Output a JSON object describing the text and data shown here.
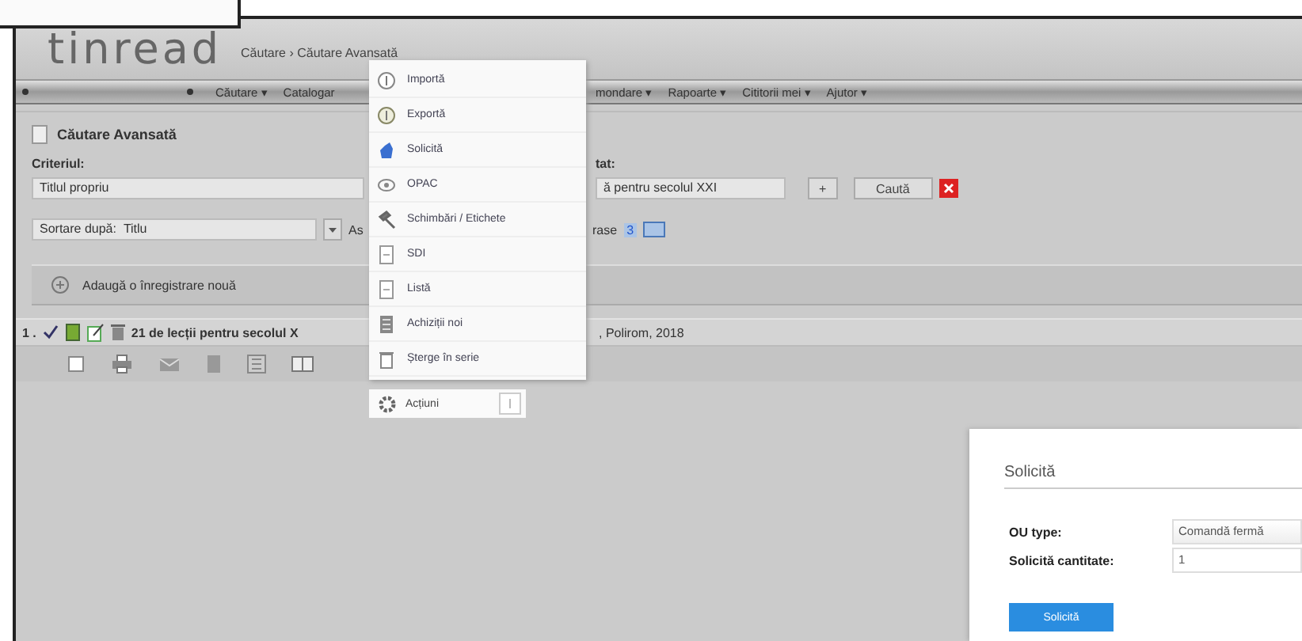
{
  "header": {
    "logo": "tinread",
    "breadcrumb": "Căutare › Căutare Avansată"
  },
  "nav": {
    "items": [
      {
        "label": "Căutare ▾"
      },
      {
        "label": "Catalogar"
      },
      {
        "label": "mondare ▾"
      },
      {
        "label": "Rapoarte ▾"
      },
      {
        "label": "Cititorii mei ▾"
      },
      {
        "label": "Ajutor ▾"
      }
    ]
  },
  "section_title": "Căutare Avansată",
  "criteria": {
    "label": "Criteriul:",
    "value": "Titlul propriu",
    "result_label": "tat:",
    "search_value": "ă pentru secolul XXI",
    "add_button": "+",
    "search_button": "Caută"
  },
  "sort": {
    "label": "Sortare după:",
    "value": "Titlu",
    "order": "As",
    "records_label": "rase",
    "records_count": "3"
  },
  "add_record": "Adaugă o înregistrare nouă",
  "results": [
    {
      "number": "1 .",
      "checked": true,
      "title": "21 de lecții pentru secolul X",
      "publisher": ", Polirom, 2018"
    }
  ],
  "menu": {
    "items": [
      {
        "label": "Importă",
        "kind": "import"
      },
      {
        "label": "Exportă",
        "kind": "export"
      },
      {
        "label": "Solicită",
        "kind": "hand"
      },
      {
        "label": "OPAC",
        "kind": "eye"
      },
      {
        "label": "Schimbări / Etichete",
        "kind": "hammer"
      },
      {
        "label": "SDI",
        "kind": "doc"
      },
      {
        "label": "Listă",
        "kind": "doc"
      },
      {
        "label": "Achiziții noi",
        "kind": "list"
      },
      {
        "label": "Șterge în serie",
        "kind": "trash"
      }
    ],
    "actions_button": "Acțiuni"
  },
  "dialog": {
    "title": "Solicită",
    "fields": [
      {
        "label": "OU type:",
        "kind": "select",
        "value": "Comandă fermă"
      },
      {
        "label": "Solicită cantitate:",
        "kind": "text",
        "value": "1"
      }
    ],
    "submit": "Solicită"
  }
}
